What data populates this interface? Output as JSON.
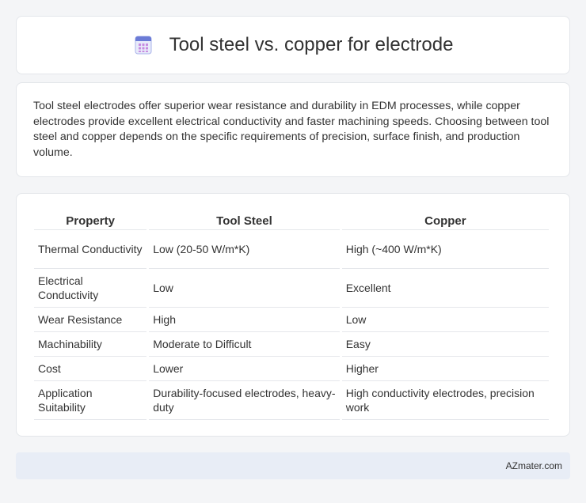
{
  "header": {
    "title": "Tool steel vs. copper for electrode",
    "icon": "calculator-icon",
    "accent": "#6b7bd6"
  },
  "intro": {
    "text": "Tool steel electrodes offer superior wear resistance and durability in EDM processes, while copper electrodes provide excellent electrical conductivity and faster machining speeds. Choosing between tool steel and copper depends on the specific requirements of precision, surface finish, and production volume."
  },
  "table": {
    "headers": [
      "Property",
      "Tool Steel",
      "Copper"
    ],
    "rows": [
      [
        "Thermal Conductivity",
        "Low (20-50 W/m*K)",
        "High (~400 W/m*K)"
      ],
      [
        "Electrical Conductivity",
        "Low",
        "Excellent"
      ],
      [
        "Wear Resistance",
        "High",
        "Low"
      ],
      [
        "Machinability",
        "Moderate to Difficult",
        "Easy"
      ],
      [
        "Cost",
        "Lower",
        "Higher"
      ],
      [
        "Application Suitability",
        "Durability-focused electrodes, heavy-duty",
        "High conductivity electrodes, precision work"
      ]
    ]
  },
  "footer": {
    "text": "AZmater.com"
  }
}
